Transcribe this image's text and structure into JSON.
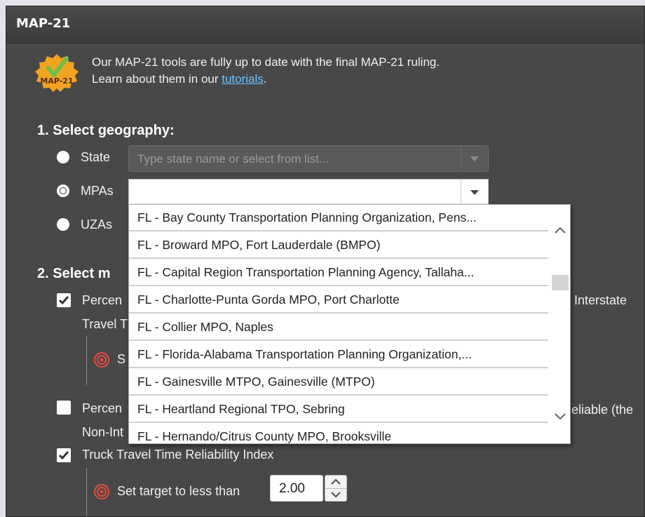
{
  "panel": {
    "title": "MAP-21"
  },
  "notice": {
    "badge_text": "MAP-21",
    "line1": "Our MAP-21 tools are fully up to date with the final MAP-21 ruling.",
    "line2_prefix": "Learn about them in our ",
    "link": "tutorials",
    "line2_suffix": "."
  },
  "section1": {
    "title": "1. Select geography:",
    "options": [
      {
        "label": "State",
        "selected": false
      },
      {
        "label": "MPAs",
        "selected": true
      },
      {
        "label": "UZAs",
        "selected": false
      }
    ],
    "state_placeholder": "Type state name or select from list...",
    "mpa_value": ""
  },
  "section2": {
    "title_visible": "2. Select m"
  },
  "background_fragments": {
    "measure1_start": "Percen",
    "measure1_end": "Interstate",
    "measure1_line2": "Travel T",
    "target1_start": "S",
    "measure2_start": "Percen",
    "measure2_end": "eliable (the",
    "measure2_line2": "Non-Int"
  },
  "measure3": {
    "label": "Truck Travel Time Reliability Index",
    "checked": true,
    "target_label": "Set target to less than",
    "target_value": "2.00"
  },
  "dropdown": {
    "items": [
      "FL - Bay County Transportation Planning Organization, Pens...",
      "FL - Broward MPO, Fort Lauderdale (BMPO)",
      "FL - Capital Region Transportation Planning Agency, Tallaha...",
      "FL - Charlotte-Punta Gorda MPO, Port Charlotte",
      "FL - Collier MPO, Naples",
      "FL - Florida-Alabama Transportation Planning Organization,...",
      "FL - Gainesville MTPO, Gainesville (MTPO)",
      "FL - Heartland Regional TPO, Sebring",
      "FL - Hernando/Citrus County MPO, Brooksville"
    ]
  },
  "colors": {
    "panel_bg": "#484848",
    "link": "#6ec3ff",
    "badge_orange": "#f2a41f",
    "check_green": "#6cc04a",
    "target_red": "#e84c3d"
  },
  "icons": {
    "badge": "map21-badge-icon",
    "target": "target-icon",
    "checkbox": "checkmark-icon",
    "caret": "chevron-down-icon",
    "scroll_up": "chevron-up-icon",
    "scroll_down": "chevron-down-icon"
  }
}
